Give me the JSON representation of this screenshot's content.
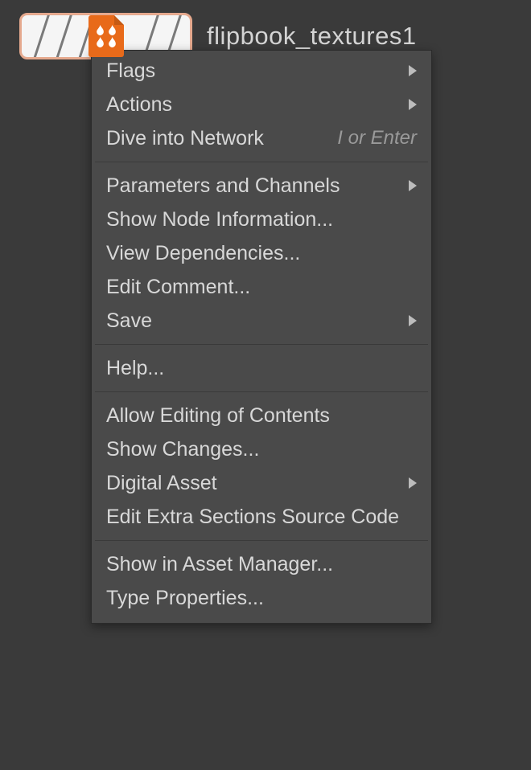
{
  "node": {
    "label": "flipbook_textures1",
    "icon": "fire-page-icon"
  },
  "menu": {
    "groups": [
      [
        {
          "label": "Flags",
          "submenu": true
        },
        {
          "label": "Actions",
          "submenu": true
        },
        {
          "label": "Dive into Network",
          "shortcut": "I or Enter"
        }
      ],
      [
        {
          "label": "Parameters and Channels",
          "submenu": true
        },
        {
          "label": "Show Node Information..."
        },
        {
          "label": "View Dependencies..."
        },
        {
          "label": "Edit Comment..."
        },
        {
          "label": "Save",
          "submenu": true
        }
      ],
      [
        {
          "label": "Help..."
        }
      ],
      [
        {
          "label": "Allow Editing of Contents"
        },
        {
          "label": "Show Changes..."
        },
        {
          "label": "Digital Asset",
          "submenu": true
        },
        {
          "label": "Edit Extra Sections Source Code"
        }
      ],
      [
        {
          "label": "Show in Asset Manager..."
        },
        {
          "label": "Type Properties..."
        }
      ]
    ]
  }
}
